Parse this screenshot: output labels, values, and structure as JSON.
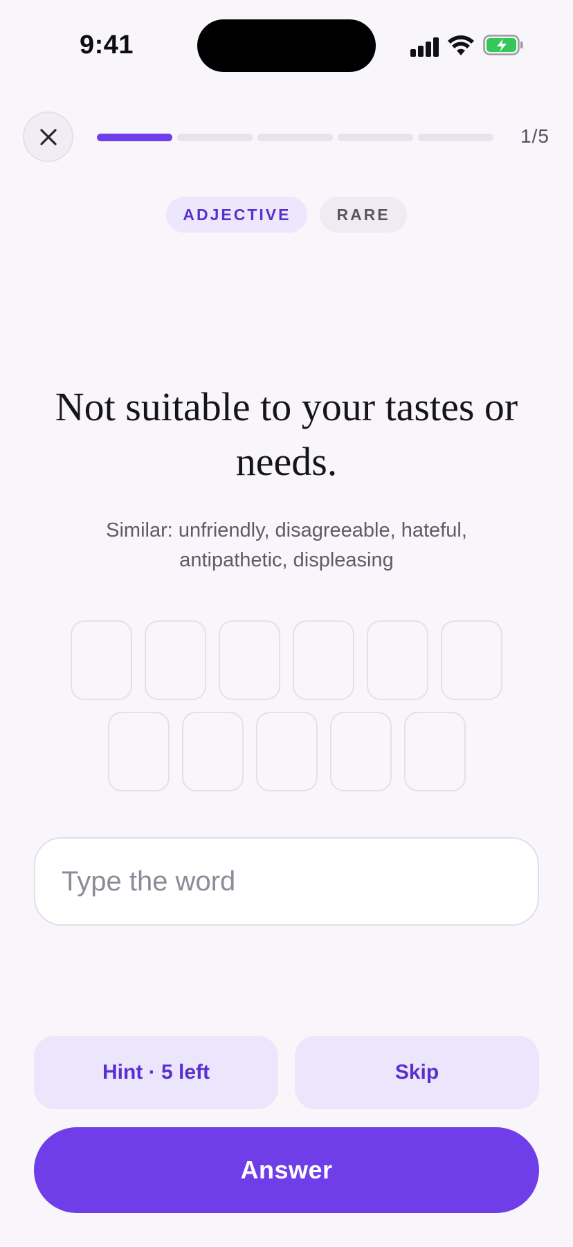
{
  "status_bar": {
    "time": "9:41",
    "icons": [
      "signal-icon",
      "wifi-icon",
      "battery-charging-icon"
    ]
  },
  "header": {
    "close_icon": "close-icon",
    "progress": {
      "current": 1,
      "total": 5
    },
    "counter": "1/5"
  },
  "tags": {
    "part_of_speech": "ADJECTIVE",
    "frequency": "RARE"
  },
  "prompt": {
    "definition": "Not suitable to your tastes or needs.",
    "similar": "Similar: unfriendly, disagreeable, hateful, antipathetic, displeasing"
  },
  "letter_boxes": {
    "row1_count": 6,
    "row2_count": 5
  },
  "input": {
    "placeholder": "Type the word",
    "value": ""
  },
  "actions": {
    "hint_label": "Hint · 5 left",
    "skip_label": "Skip",
    "answer_label": "Answer"
  },
  "colors": {
    "accent": "#6f3ee8",
    "accent_soft": "#ebe6fb",
    "background": "#f8f6fa",
    "battery_green": "#34c759"
  }
}
